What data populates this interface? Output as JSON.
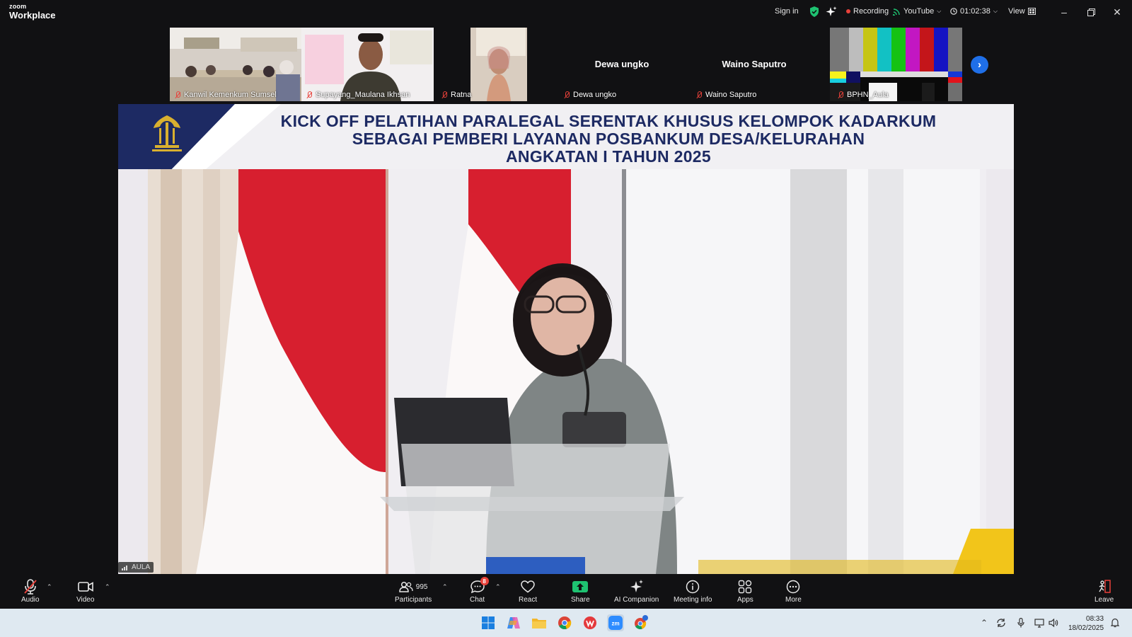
{
  "app": {
    "brand_small": "zoom",
    "brand_big": "Workplace"
  },
  "titlebar": {
    "sign_in": "Sign in",
    "recording": "Recording",
    "stream": "YouTube",
    "timer": "01:02:38",
    "view": "View"
  },
  "participants_strip": [
    {
      "name": "Kanwil Kemenkum Sumsel"
    },
    {
      "name": "Supayang_Maulana Ikhsan"
    },
    {
      "name": "Ratna"
    },
    {
      "name": "Dewa ungko",
      "center_label": "Dewa ungko"
    },
    {
      "name": "Waino Saputro",
      "center_label": "Waino Saputro"
    },
    {
      "name": "BPHN_Aula"
    }
  ],
  "main_video": {
    "banner_line1": "KICK OFF PELATIHAN PARALEGAL SERENTAK KHUSUS KELOMPOK KADARKUM",
    "banner_line2": "SEBAGAI PEMBERI LAYANAN POSBANKUM DESA/KELURAHAN",
    "banner_line3": "ANGKATAN I TAHUN 2025",
    "speaker_label": "AULA"
  },
  "toolbar": {
    "audio": "Audio",
    "video": "Video",
    "participants": "Participants",
    "participants_count": "995",
    "chat": "Chat",
    "chat_badge": "8",
    "react": "React",
    "share": "Share",
    "ai_companion": "AI Companion",
    "meeting_info": "Meeting info",
    "apps": "Apps",
    "more": "More",
    "leave": "Leave"
  },
  "taskbar": {
    "time": "08:33",
    "date": "18/02/2025"
  },
  "colors": {
    "background": "#111113",
    "accent_blue": "#1f6fe8",
    "record_red": "#e8413a",
    "share_green": "#1ec271",
    "banner_navy": "#1d2a63"
  }
}
